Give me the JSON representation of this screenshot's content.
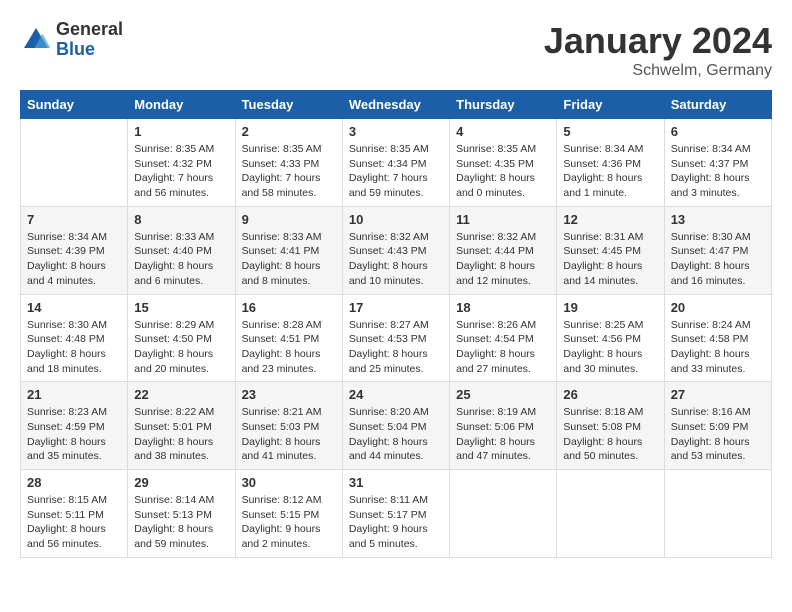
{
  "header": {
    "logo_general": "General",
    "logo_blue": "Blue",
    "title": "January 2024",
    "subtitle": "Schwelm, Germany"
  },
  "days_of_week": [
    "Sunday",
    "Monday",
    "Tuesday",
    "Wednesday",
    "Thursday",
    "Friday",
    "Saturday"
  ],
  "weeks": [
    [
      {
        "day": "",
        "info": ""
      },
      {
        "day": "1",
        "info": "Sunrise: 8:35 AM\nSunset: 4:32 PM\nDaylight: 7 hours\nand 56 minutes."
      },
      {
        "day": "2",
        "info": "Sunrise: 8:35 AM\nSunset: 4:33 PM\nDaylight: 7 hours\nand 58 minutes."
      },
      {
        "day": "3",
        "info": "Sunrise: 8:35 AM\nSunset: 4:34 PM\nDaylight: 7 hours\nand 59 minutes."
      },
      {
        "day": "4",
        "info": "Sunrise: 8:35 AM\nSunset: 4:35 PM\nDaylight: 8 hours\nand 0 minutes."
      },
      {
        "day": "5",
        "info": "Sunrise: 8:34 AM\nSunset: 4:36 PM\nDaylight: 8 hours\nand 1 minute."
      },
      {
        "day": "6",
        "info": "Sunrise: 8:34 AM\nSunset: 4:37 PM\nDaylight: 8 hours\nand 3 minutes."
      }
    ],
    [
      {
        "day": "7",
        "info": "Sunrise: 8:34 AM\nSunset: 4:39 PM\nDaylight: 8 hours\nand 4 minutes."
      },
      {
        "day": "8",
        "info": "Sunrise: 8:33 AM\nSunset: 4:40 PM\nDaylight: 8 hours\nand 6 minutes."
      },
      {
        "day": "9",
        "info": "Sunrise: 8:33 AM\nSunset: 4:41 PM\nDaylight: 8 hours\nand 8 minutes."
      },
      {
        "day": "10",
        "info": "Sunrise: 8:32 AM\nSunset: 4:43 PM\nDaylight: 8 hours\nand 10 minutes."
      },
      {
        "day": "11",
        "info": "Sunrise: 8:32 AM\nSunset: 4:44 PM\nDaylight: 8 hours\nand 12 minutes."
      },
      {
        "day": "12",
        "info": "Sunrise: 8:31 AM\nSunset: 4:45 PM\nDaylight: 8 hours\nand 14 minutes."
      },
      {
        "day": "13",
        "info": "Sunrise: 8:30 AM\nSunset: 4:47 PM\nDaylight: 8 hours\nand 16 minutes."
      }
    ],
    [
      {
        "day": "14",
        "info": "Sunrise: 8:30 AM\nSunset: 4:48 PM\nDaylight: 8 hours\nand 18 minutes."
      },
      {
        "day": "15",
        "info": "Sunrise: 8:29 AM\nSunset: 4:50 PM\nDaylight: 8 hours\nand 20 minutes."
      },
      {
        "day": "16",
        "info": "Sunrise: 8:28 AM\nSunset: 4:51 PM\nDaylight: 8 hours\nand 23 minutes."
      },
      {
        "day": "17",
        "info": "Sunrise: 8:27 AM\nSunset: 4:53 PM\nDaylight: 8 hours\nand 25 minutes."
      },
      {
        "day": "18",
        "info": "Sunrise: 8:26 AM\nSunset: 4:54 PM\nDaylight: 8 hours\nand 27 minutes."
      },
      {
        "day": "19",
        "info": "Sunrise: 8:25 AM\nSunset: 4:56 PM\nDaylight: 8 hours\nand 30 minutes."
      },
      {
        "day": "20",
        "info": "Sunrise: 8:24 AM\nSunset: 4:58 PM\nDaylight: 8 hours\nand 33 minutes."
      }
    ],
    [
      {
        "day": "21",
        "info": "Sunrise: 8:23 AM\nSunset: 4:59 PM\nDaylight: 8 hours\nand 35 minutes."
      },
      {
        "day": "22",
        "info": "Sunrise: 8:22 AM\nSunset: 5:01 PM\nDaylight: 8 hours\nand 38 minutes."
      },
      {
        "day": "23",
        "info": "Sunrise: 8:21 AM\nSunset: 5:03 PM\nDaylight: 8 hours\nand 41 minutes."
      },
      {
        "day": "24",
        "info": "Sunrise: 8:20 AM\nSunset: 5:04 PM\nDaylight: 8 hours\nand 44 minutes."
      },
      {
        "day": "25",
        "info": "Sunrise: 8:19 AM\nSunset: 5:06 PM\nDaylight: 8 hours\nand 47 minutes."
      },
      {
        "day": "26",
        "info": "Sunrise: 8:18 AM\nSunset: 5:08 PM\nDaylight: 8 hours\nand 50 minutes."
      },
      {
        "day": "27",
        "info": "Sunrise: 8:16 AM\nSunset: 5:09 PM\nDaylight: 8 hours\nand 53 minutes."
      }
    ],
    [
      {
        "day": "28",
        "info": "Sunrise: 8:15 AM\nSunset: 5:11 PM\nDaylight: 8 hours\nand 56 minutes."
      },
      {
        "day": "29",
        "info": "Sunrise: 8:14 AM\nSunset: 5:13 PM\nDaylight: 8 hours\nand 59 minutes."
      },
      {
        "day": "30",
        "info": "Sunrise: 8:12 AM\nSunset: 5:15 PM\nDaylight: 9 hours\nand 2 minutes."
      },
      {
        "day": "31",
        "info": "Sunrise: 8:11 AM\nSunset: 5:17 PM\nDaylight: 9 hours\nand 5 minutes."
      },
      {
        "day": "",
        "info": ""
      },
      {
        "day": "",
        "info": ""
      },
      {
        "day": "",
        "info": ""
      }
    ]
  ]
}
